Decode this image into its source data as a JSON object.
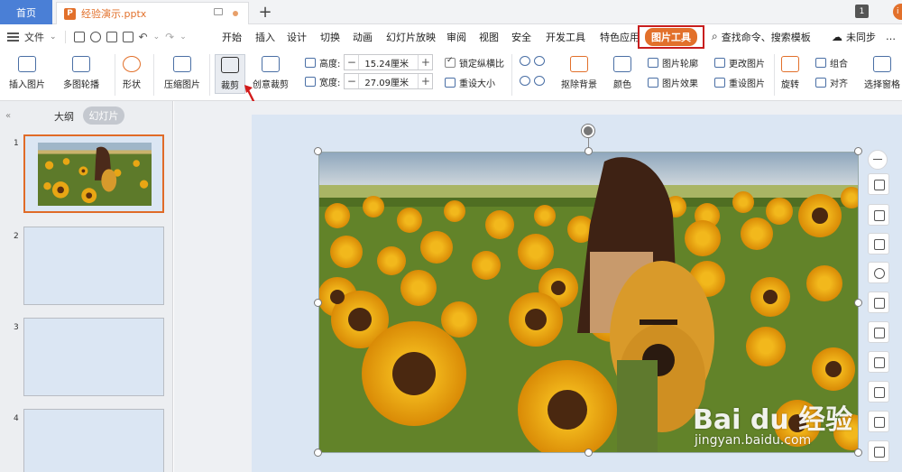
{
  "tabs": {
    "home": "首页",
    "doc_logo": "P",
    "doc_title": "经验演示.pptx",
    "new_tab": "+",
    "window_badge": "1",
    "avatar_text": "i"
  },
  "menu": {
    "file": "文件",
    "items": [
      "开始",
      "插入",
      "设计",
      "切换",
      "动画",
      "幻灯片放映",
      "审阅",
      "视图",
      "安全",
      "开发工具",
      "特色应用"
    ],
    "picture_tools": "图片工具",
    "search": "查找命令、搜索模板",
    "sync": "未同步",
    "share": "…"
  },
  "ribbon": {
    "insert_picture": "插入图片",
    "multi_outline": "多图轮播",
    "shape": "形状",
    "compress": "压缩图片",
    "crop": "裁剪",
    "creative_crop": "创意裁剪",
    "height_label": "高度:",
    "height_value": "15.24厘米",
    "width_label": "宽度:",
    "width_value": "27.09厘米",
    "lock_ratio": "锁定纵横比",
    "reset_size": "重设大小",
    "remove_bg": "抠除背景",
    "color": "颜色",
    "picture_outline": "图片轮廓",
    "picture_effect": "图片效果",
    "change_picture": "更改图片",
    "reset_picture": "重设图片",
    "rotate": "旋转",
    "group": "组合",
    "align": "对齐",
    "selection_pane": "选择窗格"
  },
  "left_panel": {
    "collapse": "«",
    "outline_tab": "大纲",
    "slides_tab": "幻灯片",
    "slide_numbers": [
      "1",
      "2",
      "3",
      "4"
    ]
  },
  "watermark": {
    "brand": "Bai du 经验",
    "url": "jingyan.baidu.com"
  }
}
